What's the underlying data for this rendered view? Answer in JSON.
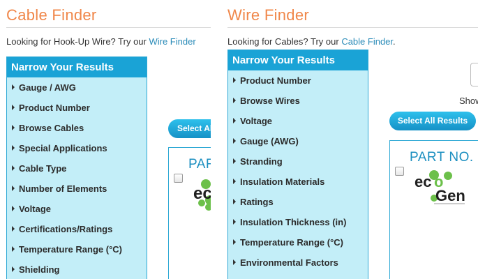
{
  "cable_finder": {
    "title": "Cable Finder",
    "intro_text": "Looking for Hook-Up Wire?  Try our ",
    "intro_link": "Wire Finder",
    "narrow_header": "Narrow Your Results",
    "filters": [
      "Gauge / AWG",
      "Product Number",
      "Browse Cables",
      "Special Applications",
      "Cable Type",
      "Number of Elements",
      "Voltage",
      "Certifications/Ratings",
      "Temperature Range (°C)",
      "Shielding"
    ],
    "select_all_label": "Select All Results",
    "part_label": "PART NO.",
    "logo_text": "ecoGen"
  },
  "wire_finder": {
    "title": "Wire Finder",
    "intro_text": "Looking for Cables? Try our ",
    "intro_link": "Cable Finder",
    "intro_suffix": ".",
    "narrow_header": "Narrow Your Results",
    "filters": [
      "Product Number",
      "Browse Wires",
      "Voltage",
      "Gauge (AWG)",
      "Stranding",
      "Insulation Materials",
      "Ratings",
      "Insulation Thickness (in)",
      "Temperature Range (°C)",
      "Environmental Factors"
    ],
    "show_label": "Show",
    "select_all_label": "Select All Results",
    "part_label": "PART NO.",
    "logo_text": "ecoGen"
  },
  "colors": {
    "title_orange": "#f0874a",
    "accent_blue": "#1aa3d6",
    "panel_bg": "#c3eef8",
    "link_blue": "#2a8bb8",
    "eco_green": "#6cc04a"
  }
}
